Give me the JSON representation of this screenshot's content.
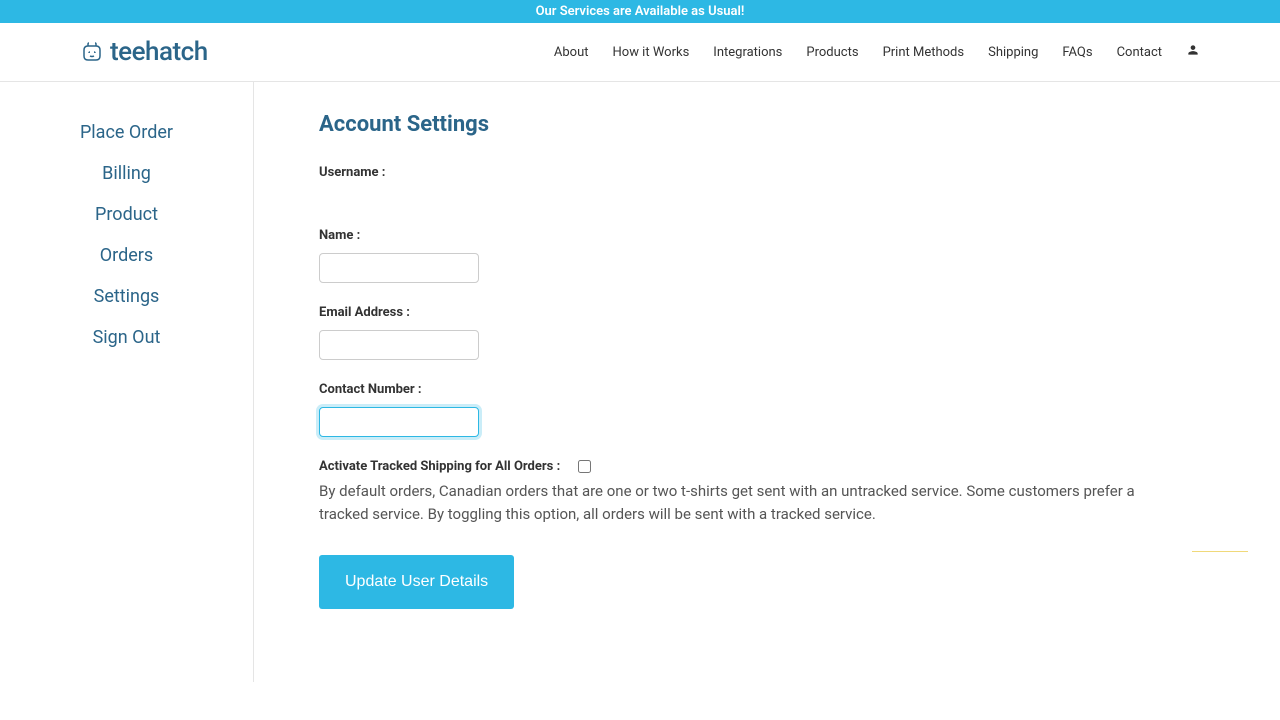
{
  "announcement": "Our Services are Available as Usual!",
  "brand": "teehatch",
  "nav": {
    "items": [
      "About",
      "How it Works",
      "Integrations",
      "Products",
      "Print Methods",
      "Shipping",
      "FAQs",
      "Contact"
    ]
  },
  "sidebar": {
    "items": [
      "Place Order",
      "Billing",
      "Product",
      "Orders",
      "Settings",
      "Sign Out"
    ]
  },
  "main": {
    "title": "Account Settings",
    "username_label": "Username :",
    "name_label": "Name :",
    "name_value": "",
    "email_label": "Email Address :",
    "email_value": "",
    "contact_label": "Contact Number :",
    "contact_value": "",
    "tracked_label": "Activate Tracked Shipping for All Orders :",
    "tracked_checked": false,
    "tracked_help": "By default orders, Canadian orders that are one or two t-shirts get sent with an untracked service. Some customers prefer a tracked service. By toggling this option, all orders will be sent with a tracked service.",
    "submit_label": "Update User Details"
  }
}
